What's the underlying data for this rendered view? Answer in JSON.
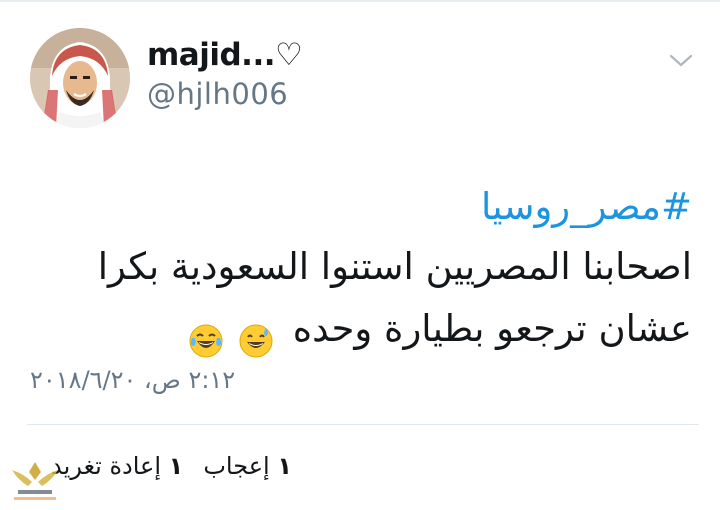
{
  "user": {
    "display_name": "majid...♡",
    "handle": "@hjlh006"
  },
  "tweet": {
    "hashtag": "#مصر_روسيا",
    "lines": [
      "اصحابنا المصريين استنوا السعودية بكرا",
      "عشان ترجعو بطيارة وحده"
    ],
    "emojis": [
      "grinning-sweat-emoji",
      "tears-of-joy-emoji"
    ],
    "timestamp": "٢:١٢ ص، ٢٠١٨/٦/٢٠"
  },
  "stats": {
    "retweets_count": "١",
    "retweets_label": "إعادة تغريد",
    "likes_count": "١",
    "likes_label": "إعجاب"
  },
  "colors": {
    "link": "#1b95e0",
    "secondary_text": "#657786",
    "divider": "#e1e8ed"
  },
  "icons": {
    "menu": "chevron-down-icon",
    "watermark": "watermark-logo"
  }
}
